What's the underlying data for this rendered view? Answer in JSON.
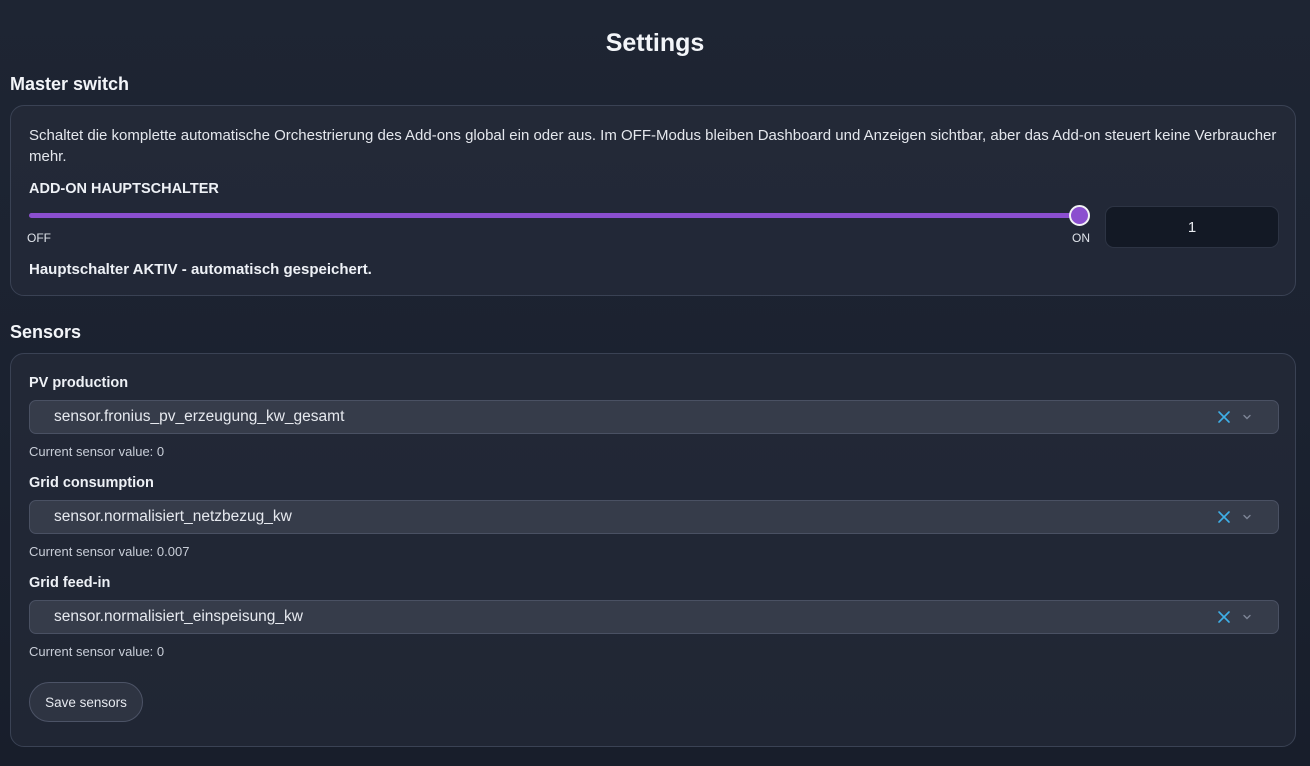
{
  "page": {
    "title": "Settings"
  },
  "master": {
    "section_title": "Master switch",
    "description": "Schaltet die komplette automatische Orchestrierung des Add-ons global ein oder aus. Im OFF-Modus bleiben Dashboard und Anzeigen sichtbar, aber das Add-on steuert keine Verbraucher mehr.",
    "label": "ADD-ON HAUPTSCHALTER",
    "off_label": "OFF",
    "on_label": "ON",
    "value": "1",
    "slider_level": 1,
    "status": "Hauptschalter AKTIV - automatisch gespeichert.",
    "accent_color": "#8b4fcf"
  },
  "sensors": {
    "section_title": "Sensors",
    "items": [
      {
        "label": "PV production",
        "entity": "sensor.fronius_pv_erzeugung_kw_gesamt",
        "current": "Current sensor value: 0"
      },
      {
        "label": "Grid consumption",
        "entity": "sensor.normalisiert_netzbezug_kw",
        "current": "Current sensor value: 0.007"
      },
      {
        "label": "Grid feed-in",
        "entity": "sensor.normalisiert_einspeisung_kw",
        "current": "Current sensor value: 0"
      }
    ],
    "save_label": "Save sensors",
    "clear_icon": "close-icon",
    "dropdown_icon": "chevron-down-icon",
    "clear_icon_color": "#3fb0e8"
  }
}
